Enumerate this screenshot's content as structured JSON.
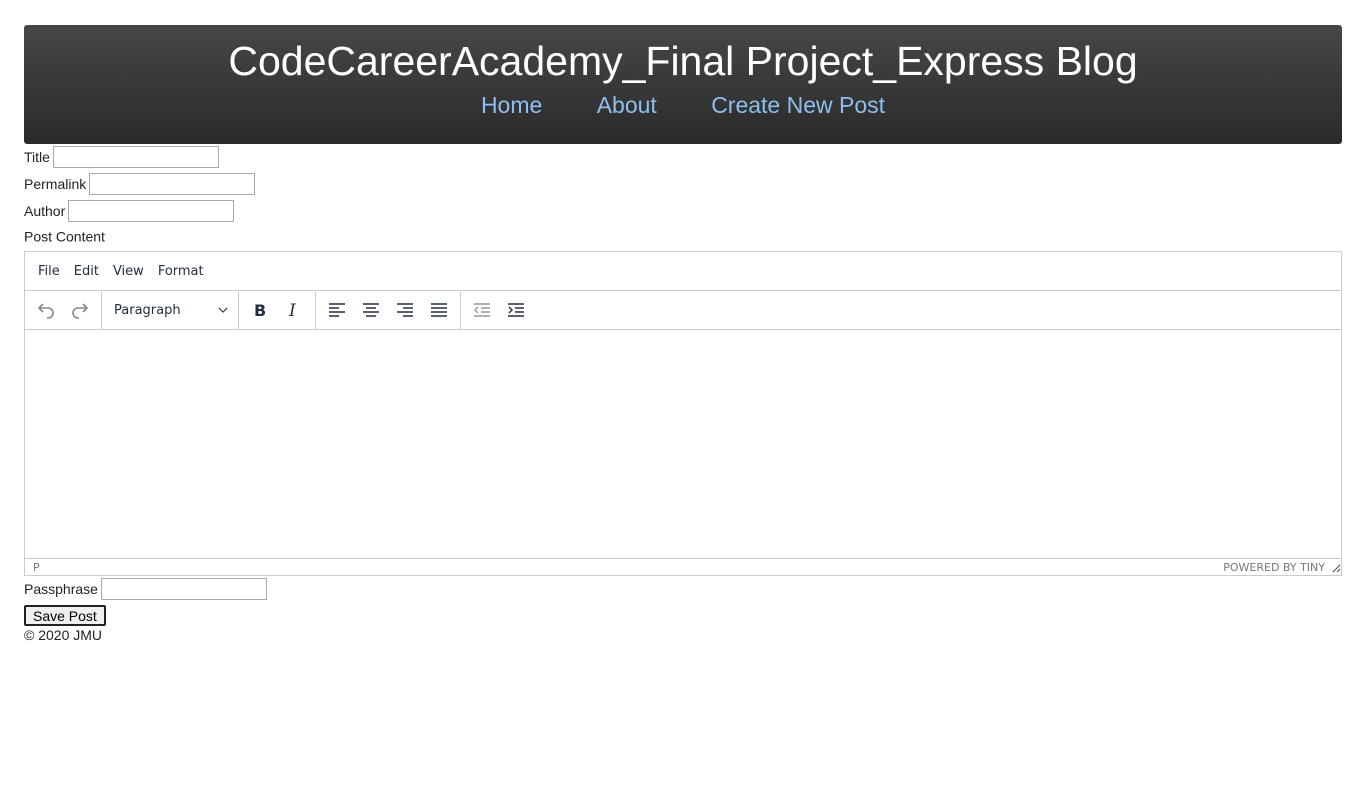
{
  "header": {
    "title": "CodeCareerAcademy_Final Project_Express Blog",
    "nav": [
      "Home",
      "About",
      "Create New Post"
    ],
    "link_color": "#8ebfee"
  },
  "form": {
    "title_label": "Title",
    "title_value": "",
    "permalink_label": "Permalink",
    "permalink_value": "",
    "author_label": "Author",
    "author_value": "",
    "content_label": "Post Content",
    "passphrase_label": "Passphrase",
    "passphrase_value": "",
    "save_label": "Save Post"
  },
  "editor": {
    "menu": [
      "File",
      "Edit",
      "View",
      "Format"
    ],
    "block_format": "Paragraph",
    "status_path": "P",
    "branding": "POWERED BY TINY",
    "icons": [
      "undo-icon",
      "redo-icon",
      "chevron-down-icon",
      "bold-icon",
      "italic-icon",
      "align-left-icon",
      "align-center-icon",
      "align-right-icon",
      "justify-icon",
      "outdent-icon",
      "indent-icon",
      "resize-handle-icon"
    ]
  },
  "footer": {
    "text": "© 2020 JMU"
  }
}
